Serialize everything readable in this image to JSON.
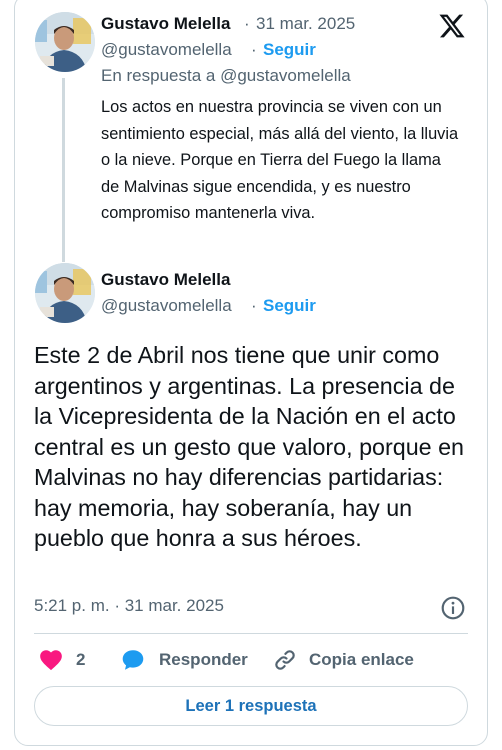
{
  "reply_tweet": {
    "author_name": "Gustavo Melella",
    "separator": "·",
    "date": "31 mar. 2025",
    "handle": "@gustavomelella",
    "follow_label": "Seguir",
    "in_reply_to": "En respuesta a @gustavomelella",
    "text": "Los actos en nuestra provincia se viven con un sentimiento especial, más allá del viento, la lluvia o la nieve. Porque en Tierra del Fuego la llama de Malvinas sigue encendida, y es nuestro compromiso mantenerla viva."
  },
  "main_tweet": {
    "author_name": "Gustavo Melella",
    "handle": "@gustavomelella",
    "separator": "·",
    "follow_label": "Seguir",
    "text": "Este 2 de Abril nos tiene que unir como argentinos y argentinas. La presencia de la Vicepresidenta de la Nación en el acto central es un gesto que valoro, porque en Malvinas no hay diferencias partidarias: hay memoria, hay soberanía, hay un pueblo que honra a sus héroes.",
    "timestamp": "5:21 p. m. · 31 mar. 2025"
  },
  "actions": {
    "likes_count": "2",
    "reply_label": "Responder",
    "copy_link_label": "Copia enlace"
  },
  "read_replies_label": "Leer 1 respuesta",
  "icons": {
    "brand": "x-logo-icon",
    "like": "heart-icon",
    "reply": "speech-bubble-icon",
    "copy": "link-icon",
    "info": "info-icon"
  },
  "colors": {
    "accent": "#1d9bf0",
    "like": "#f91880",
    "text": "#0f1419",
    "muted": "#536471",
    "border": "#cfd9de"
  }
}
